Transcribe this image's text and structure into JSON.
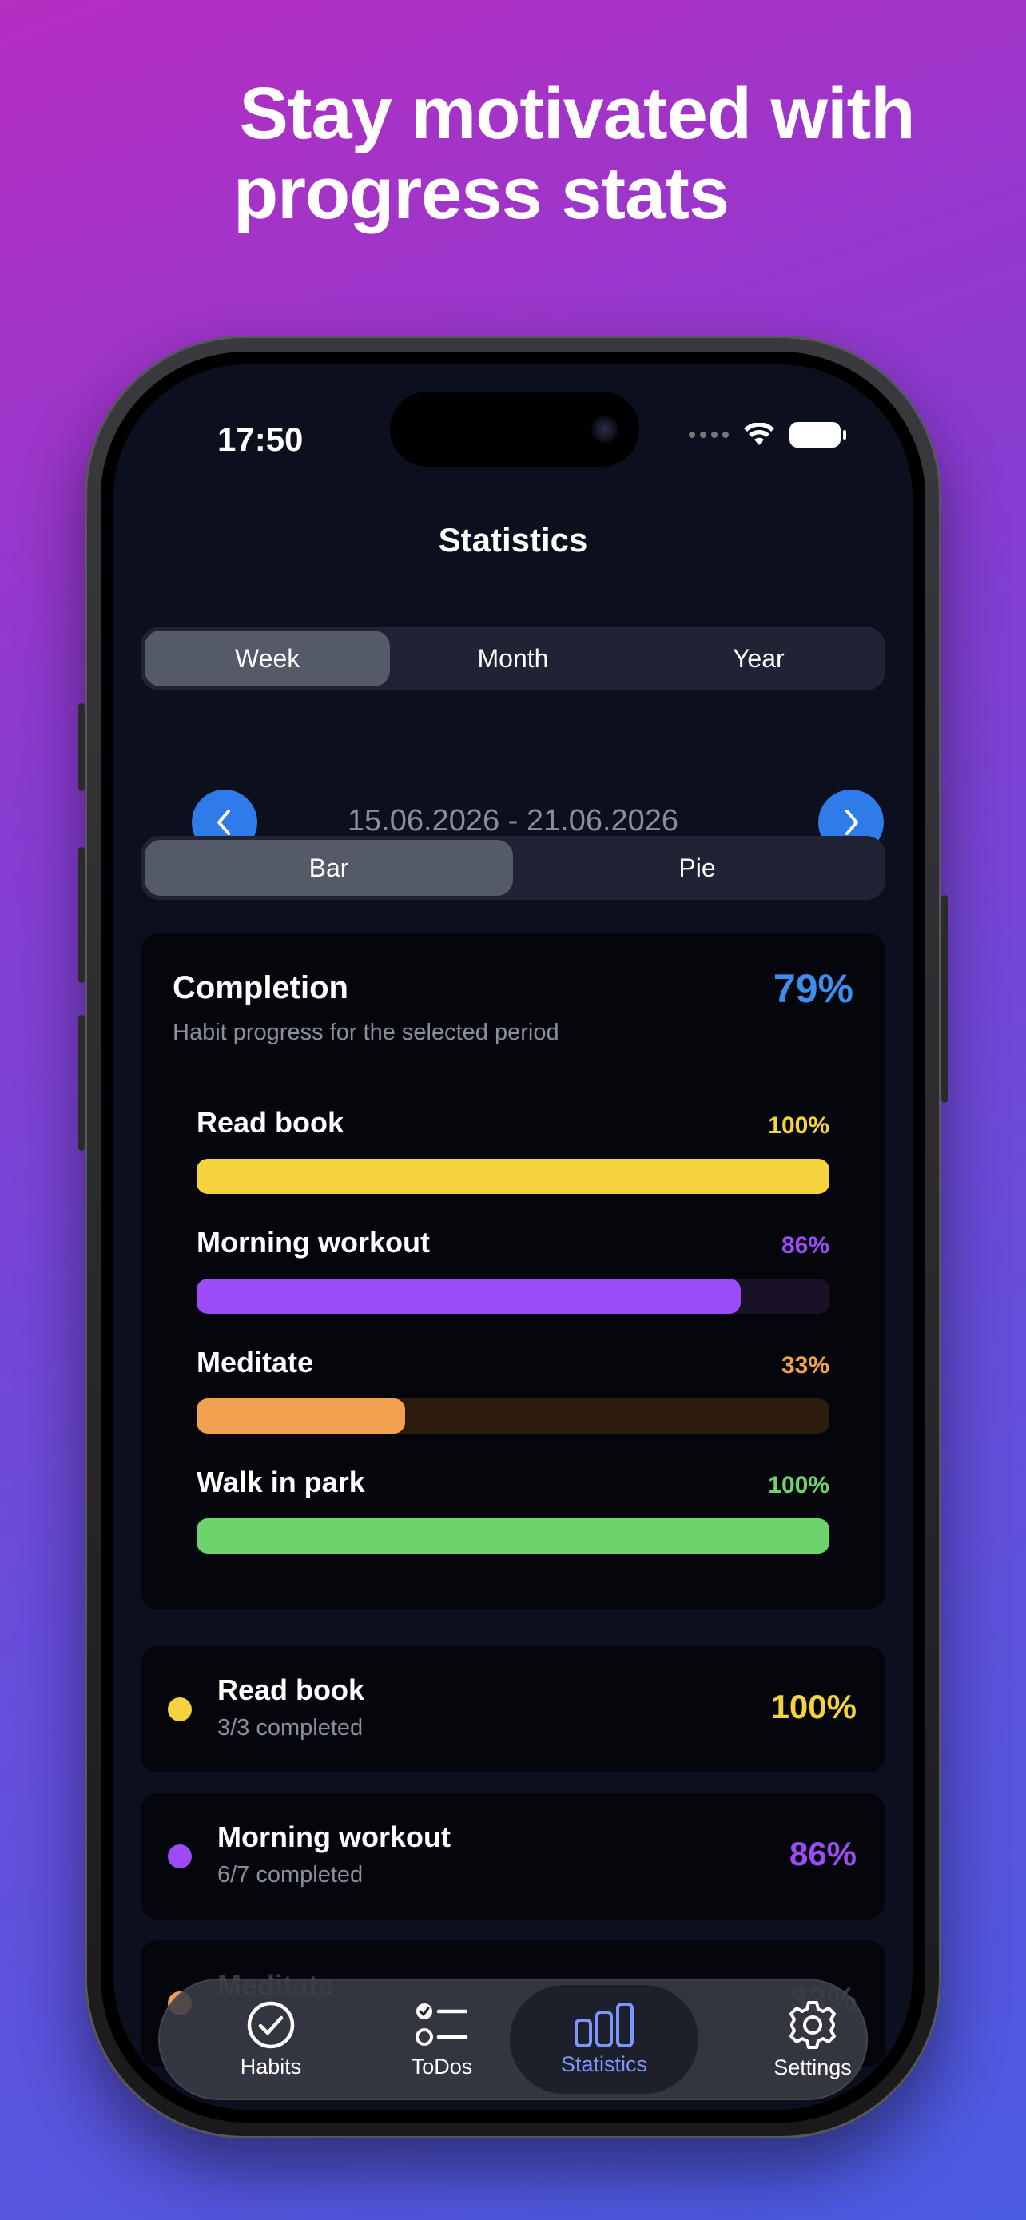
{
  "headline": {
    "line1": "Stay motivated with",
    "line2": "progress stats"
  },
  "status_bar": {
    "time": "17:50"
  },
  "screen": {
    "title": "Statistics"
  },
  "period_tabs": [
    {
      "label": "Week",
      "active": true
    },
    {
      "label": "Month",
      "active": false
    },
    {
      "label": "Year",
      "active": false
    }
  ],
  "date_range": "15.06.2026 - 21.06.2026",
  "chart_tabs": [
    {
      "label": "Bar",
      "active": true
    },
    {
      "label": "Pie",
      "active": false
    }
  ],
  "completion": {
    "title": "Completion",
    "subtitle": "Habit progress for the selected period",
    "percent": "79%"
  },
  "habits": [
    {
      "name": "Read book",
      "percent": "100%",
      "progress": 1.0,
      "color": "#f5d33f",
      "track": "#2a2408",
      "completed": "3/3 completed"
    },
    {
      "name": "Morning workout",
      "percent": "86%",
      "progress": 0.86,
      "color": "#9b4cf6",
      "track": "#1a1028",
      "completed": "6/7 completed"
    },
    {
      "name": "Meditate",
      "percent": "33%",
      "progress": 0.33,
      "color": "#f2a24f",
      "track": "#2b1c0c",
      "completed": ""
    },
    {
      "name": "Walk in park",
      "percent": "100%",
      "progress": 1.0,
      "color": "#6fd36b",
      "track": "#0f2410",
      "completed": ""
    }
  ],
  "tab_bar": [
    {
      "label": "Habits",
      "icon": "check-circle-icon",
      "active": false
    },
    {
      "label": "ToDos",
      "icon": "checklist-icon",
      "active": false
    },
    {
      "label": "Statistics",
      "icon": "bar-chart-icon",
      "active": true
    },
    {
      "label": "Settings",
      "icon": "gear-icon",
      "active": false
    }
  ]
}
